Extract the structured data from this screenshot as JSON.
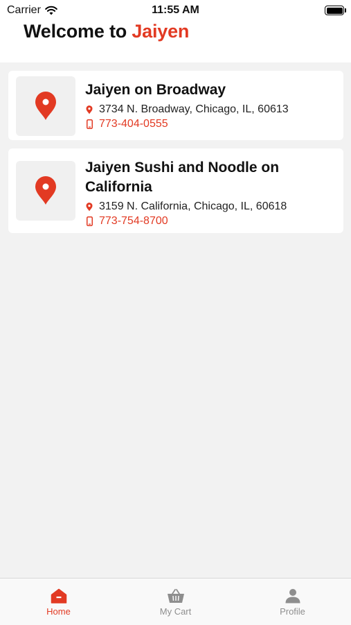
{
  "status": {
    "carrier": "Carrier",
    "time": "11:55 AM"
  },
  "header": {
    "welcome_prefix": "Welcome to ",
    "brand": "Jaiyen"
  },
  "locations": [
    {
      "name": "Jaiyen on Broadway",
      "address": "3734 N. Broadway, Chicago, IL, 60613",
      "phone": "773-404-0555"
    },
    {
      "name": "Jaiyen Sushi and Noodle on California",
      "address": "3159 N. California, Chicago, IL, 60618",
      "phone": "773-754-8700"
    }
  ],
  "tabs": [
    {
      "label": "Home",
      "icon": "home-icon",
      "active": true
    },
    {
      "label": "My Cart",
      "icon": "basket-icon",
      "active": false
    },
    {
      "label": "Profile",
      "icon": "person-icon",
      "active": false
    }
  ],
  "colors": {
    "accent": "#e23a23",
    "background": "#f2f2f2",
    "inactive": "#8e8e8e"
  }
}
